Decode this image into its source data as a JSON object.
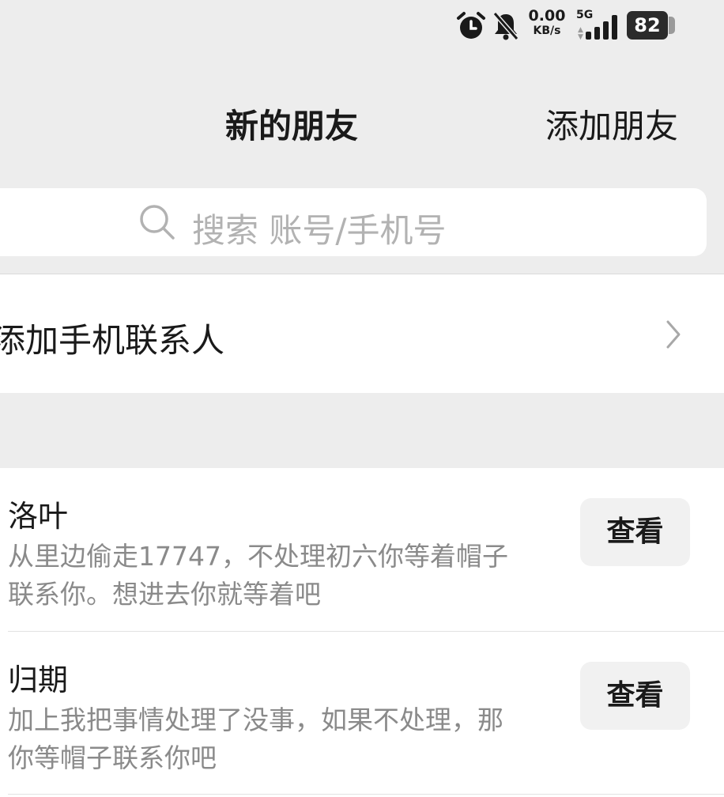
{
  "status_bar": {
    "net_speed_value": "0.00",
    "net_speed_unit": "KB/s",
    "network_type": "5G",
    "battery_level": "82",
    "icons": [
      "alarm-icon",
      "bell-muted-icon",
      "signal-icon",
      "battery-icon"
    ]
  },
  "header": {
    "title": "新的朋友",
    "add_friend_label": "添加朋友"
  },
  "search": {
    "placeholder": "搜索 账号/手机号"
  },
  "phone_contacts": {
    "label": "添加手机联系人"
  },
  "requests": [
    {
      "name": "洛叶",
      "message": "从里边偷走17747，不处理初六你等着帽子联系你。想进去你就等着吧",
      "button_label": "查看"
    },
    {
      "name": "归期",
      "message": "加上我把事情处理了没事，如果不处理，那你等帽子联系你吧",
      "button_label": "查看"
    }
  ],
  "colors": {
    "background": "#ededed",
    "card": "#ffffff",
    "text_primary": "#1a1a1a",
    "text_secondary": "#8a8a8a",
    "placeholder": "#b2b2b2",
    "button_bg": "#f1f1f1"
  }
}
